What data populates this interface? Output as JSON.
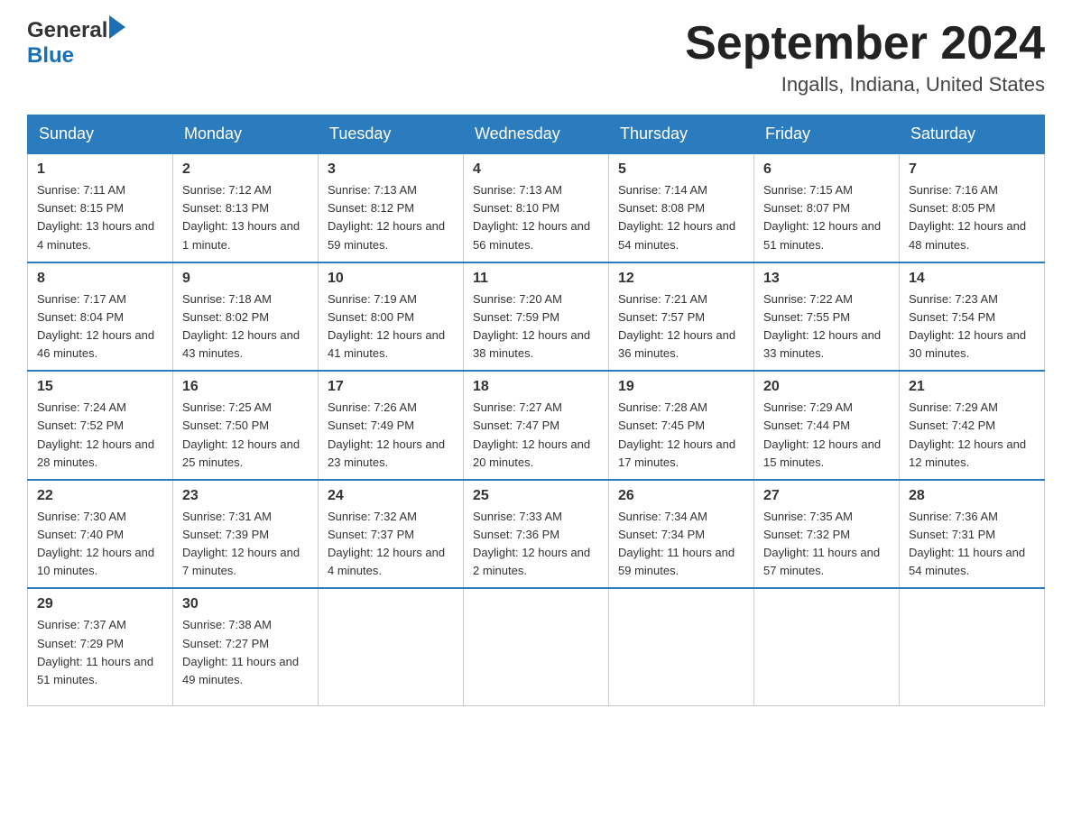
{
  "logo": {
    "general": "General",
    "blue": "Blue"
  },
  "header": {
    "month": "September 2024",
    "location": "Ingalls, Indiana, United States"
  },
  "weekdays": [
    "Sunday",
    "Monday",
    "Tuesday",
    "Wednesday",
    "Thursday",
    "Friday",
    "Saturday"
  ],
  "weeks": [
    [
      {
        "day": "1",
        "sunrise": "7:11 AM",
        "sunset": "8:15 PM",
        "daylight": "13 hours and 4 minutes."
      },
      {
        "day": "2",
        "sunrise": "7:12 AM",
        "sunset": "8:13 PM",
        "daylight": "13 hours and 1 minute."
      },
      {
        "day": "3",
        "sunrise": "7:13 AM",
        "sunset": "8:12 PM",
        "daylight": "12 hours and 59 minutes."
      },
      {
        "day": "4",
        "sunrise": "7:13 AM",
        "sunset": "8:10 PM",
        "daylight": "12 hours and 56 minutes."
      },
      {
        "day": "5",
        "sunrise": "7:14 AM",
        "sunset": "8:08 PM",
        "daylight": "12 hours and 54 minutes."
      },
      {
        "day": "6",
        "sunrise": "7:15 AM",
        "sunset": "8:07 PM",
        "daylight": "12 hours and 51 minutes."
      },
      {
        "day": "7",
        "sunrise": "7:16 AM",
        "sunset": "8:05 PM",
        "daylight": "12 hours and 48 minutes."
      }
    ],
    [
      {
        "day": "8",
        "sunrise": "7:17 AM",
        "sunset": "8:04 PM",
        "daylight": "12 hours and 46 minutes."
      },
      {
        "day": "9",
        "sunrise": "7:18 AM",
        "sunset": "8:02 PM",
        "daylight": "12 hours and 43 minutes."
      },
      {
        "day": "10",
        "sunrise": "7:19 AM",
        "sunset": "8:00 PM",
        "daylight": "12 hours and 41 minutes."
      },
      {
        "day": "11",
        "sunrise": "7:20 AM",
        "sunset": "7:59 PM",
        "daylight": "12 hours and 38 minutes."
      },
      {
        "day": "12",
        "sunrise": "7:21 AM",
        "sunset": "7:57 PM",
        "daylight": "12 hours and 36 minutes."
      },
      {
        "day": "13",
        "sunrise": "7:22 AM",
        "sunset": "7:55 PM",
        "daylight": "12 hours and 33 minutes."
      },
      {
        "day": "14",
        "sunrise": "7:23 AM",
        "sunset": "7:54 PM",
        "daylight": "12 hours and 30 minutes."
      }
    ],
    [
      {
        "day": "15",
        "sunrise": "7:24 AM",
        "sunset": "7:52 PM",
        "daylight": "12 hours and 28 minutes."
      },
      {
        "day": "16",
        "sunrise": "7:25 AM",
        "sunset": "7:50 PM",
        "daylight": "12 hours and 25 minutes."
      },
      {
        "day": "17",
        "sunrise": "7:26 AM",
        "sunset": "7:49 PM",
        "daylight": "12 hours and 23 minutes."
      },
      {
        "day": "18",
        "sunrise": "7:27 AM",
        "sunset": "7:47 PM",
        "daylight": "12 hours and 20 minutes."
      },
      {
        "day": "19",
        "sunrise": "7:28 AM",
        "sunset": "7:45 PM",
        "daylight": "12 hours and 17 minutes."
      },
      {
        "day": "20",
        "sunrise": "7:29 AM",
        "sunset": "7:44 PM",
        "daylight": "12 hours and 15 minutes."
      },
      {
        "day": "21",
        "sunrise": "7:29 AM",
        "sunset": "7:42 PM",
        "daylight": "12 hours and 12 minutes."
      }
    ],
    [
      {
        "day": "22",
        "sunrise": "7:30 AM",
        "sunset": "7:40 PM",
        "daylight": "12 hours and 10 minutes."
      },
      {
        "day": "23",
        "sunrise": "7:31 AM",
        "sunset": "7:39 PM",
        "daylight": "12 hours and 7 minutes."
      },
      {
        "day": "24",
        "sunrise": "7:32 AM",
        "sunset": "7:37 PM",
        "daylight": "12 hours and 4 minutes."
      },
      {
        "day": "25",
        "sunrise": "7:33 AM",
        "sunset": "7:36 PM",
        "daylight": "12 hours and 2 minutes."
      },
      {
        "day": "26",
        "sunrise": "7:34 AM",
        "sunset": "7:34 PM",
        "daylight": "11 hours and 59 minutes."
      },
      {
        "day": "27",
        "sunrise": "7:35 AM",
        "sunset": "7:32 PM",
        "daylight": "11 hours and 57 minutes."
      },
      {
        "day": "28",
        "sunrise": "7:36 AM",
        "sunset": "7:31 PM",
        "daylight": "11 hours and 54 minutes."
      }
    ],
    [
      {
        "day": "29",
        "sunrise": "7:37 AM",
        "sunset": "7:29 PM",
        "daylight": "11 hours and 51 minutes."
      },
      {
        "day": "30",
        "sunrise": "7:38 AM",
        "sunset": "7:27 PM",
        "daylight": "11 hours and 49 minutes."
      },
      null,
      null,
      null,
      null,
      null
    ]
  ]
}
